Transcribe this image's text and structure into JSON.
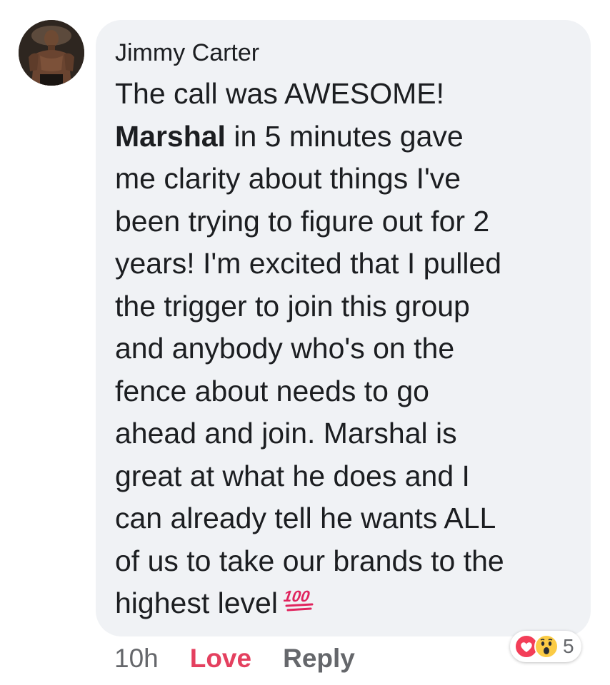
{
  "comment": {
    "author": "Jimmy Carter",
    "text_lines": [
      "The call was AWESOME!",
      " in 5 minutes gave",
      "me clarity about things I've",
      "been trying to figure out for 2",
      "years! I'm excited that I pulled",
      "the trigger to join this group",
      "and anybody who's on the",
      "fence about needs to go",
      "ahead and join. Marshal is",
      "great at what he does and I",
      "can already tell he wants ALL",
      "of us to take our brands to the",
      "highest level"
    ],
    "mention": "Marshal",
    "emoji": "100",
    "emoji_icon": "hundred-points-icon"
  },
  "footer": {
    "time": "10h",
    "love_label": "Love",
    "reply_label": "Reply"
  },
  "reactions": {
    "icons": [
      "love-reaction-icon",
      "wow-reaction-icon"
    ],
    "count": "5"
  },
  "colors": {
    "bubble": "#f0f2f5",
    "love": "#e4405f",
    "meta": "#65676b",
    "text": "#1c1e21"
  }
}
